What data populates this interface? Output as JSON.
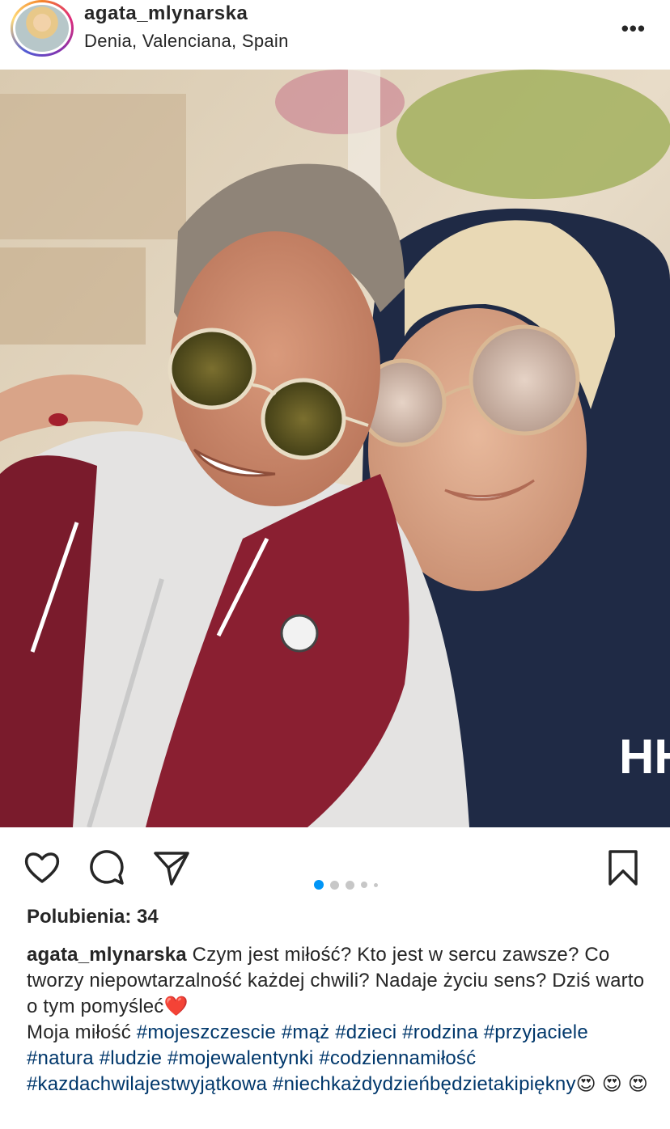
{
  "post": {
    "username": "agata_mlynarska",
    "location": "Denia, Valenciana, Spain",
    "more_label": "•••"
  },
  "photo": {
    "description_icon": "photo",
    "back_logo_text": "HH"
  },
  "carousel": {
    "active_index": 0,
    "count": 5
  },
  "likes": {
    "text": "Polubienia: 34"
  },
  "caption": {
    "username": "agata_mlynarska",
    "text": " Czym jest miłość? Kto jest w sercu zawsze? Co tworzy niepowtarzalność każdej chwili? Nadaje życiu sens? Dziś warto o tym pomyśleć❤️",
    "line2_prefix": "Moja miłość ",
    "hashtags": [
      "#mojeszczescie",
      "#mąż",
      "#dzieci",
      "#rodzina",
      "#przyjaciele",
      "#natura",
      "#ludzie",
      "#mojewalentynki",
      "#codziennamiłość",
      "#kazdachwilajestwyjątkowa",
      "#niechkażdydzieńbędzietakipiękny"
    ],
    "emoji_tail": "😍 😍 😍"
  },
  "colors": {
    "text": "#262626",
    "hashtag": "#00376b",
    "carousel_active": "#0095f6",
    "carousel_inactive": "#c7c7c7"
  }
}
